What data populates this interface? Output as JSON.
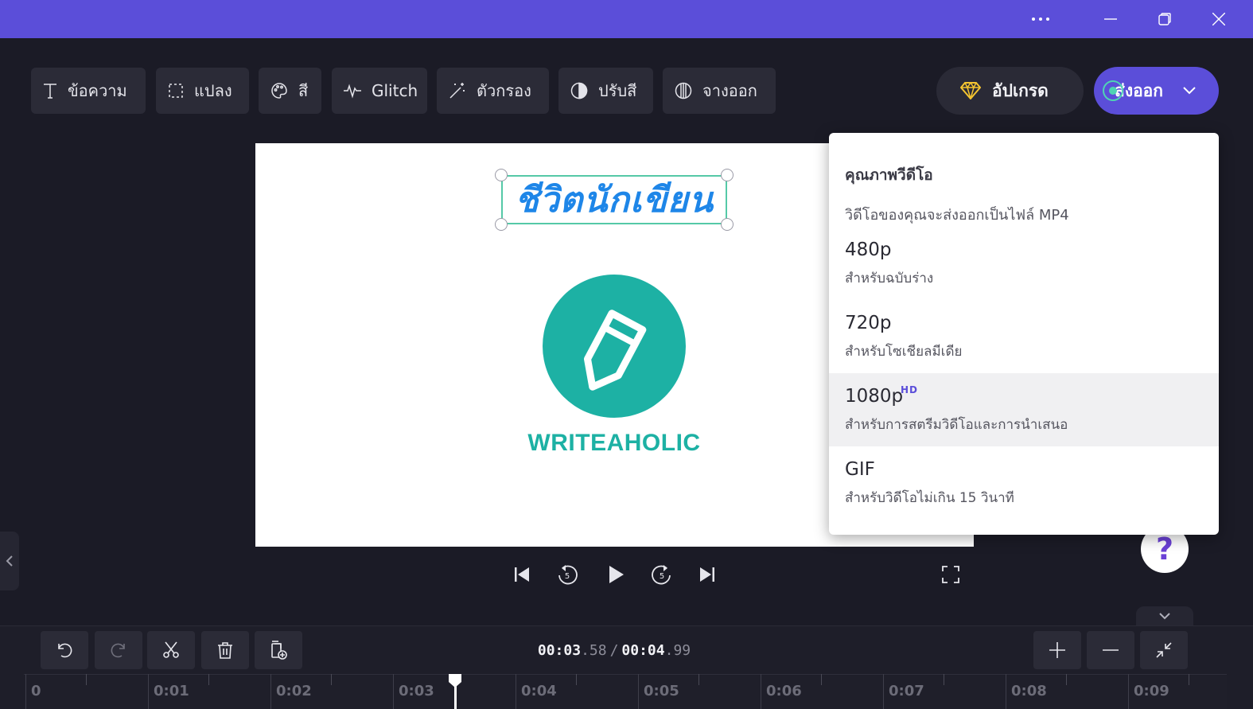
{
  "titlebar": {
    "more_icon": "ellipsis-icon",
    "minimize_icon": "minimize-icon",
    "maximize_icon": "restore-icon",
    "close_icon": "close-icon",
    "color": "#5b4ed9"
  },
  "toolbar": {
    "items": [
      {
        "label": "ข้อความ",
        "icon": "text-icon"
      },
      {
        "label": "แปลง",
        "icon": "transform-icon"
      },
      {
        "label": "สี",
        "icon": "palette-icon"
      },
      {
        "label": "Glitch",
        "icon": "glitch-icon"
      },
      {
        "label": "ตัวกรอง",
        "icon": "magic-wand-icon"
      },
      {
        "label": "ปรับสี",
        "icon": "contrast-icon"
      },
      {
        "label": "จางออก",
        "icon": "fade-icon"
      }
    ],
    "upgrade_label": "อัปเกรด",
    "export_label": "ส่งออก",
    "accent": "#5b4ed9"
  },
  "canvas": {
    "title_text": "ชีวิตนักเขียน",
    "logo_text": "WRITEAHOLIC",
    "logo_color": "#1db1a4"
  },
  "export_menu": {
    "heading": "คุณภาพวีดีโอ",
    "subtitle": "วิดีโอของคุณจะส่งออกเป็นไฟล์ MP4",
    "options": [
      {
        "title": "480p",
        "desc": "สำหรับฉบับร่าง"
      },
      {
        "title": "720p",
        "desc": "สำหรับโซเชียลมีเดีย"
      },
      {
        "title": "1080p",
        "desc": "สำหรับการสตรีมวิดีโอและการนำเสนอ",
        "badge": "HD"
      },
      {
        "title": "GIF",
        "desc": "สำหรับวิดีโอไม่เกิน 15 วินาที"
      }
    ],
    "highlighted": "1080p"
  },
  "playback": {
    "controls": [
      "skip-to-start-icon",
      "rewind-5-icon",
      "play-icon",
      "forward-5-icon",
      "skip-to-end-icon",
      "fullscreen-icon"
    ]
  },
  "help": {
    "label": "?"
  },
  "timeline": {
    "current_main": "00:03",
    "current_frac": ".58",
    "separator": "/",
    "total_main": "00:04",
    "total_frac": ".99",
    "ruler_labels": [
      "0",
      "0:01",
      "0:02",
      "0:03",
      "0:04",
      "0:05",
      "0:06",
      "0:07",
      "0:08",
      "0:09"
    ],
    "tools": [
      "undo-icon",
      "redo-icon",
      "scissors-icon",
      "trash-icon",
      "duplicate-icon"
    ],
    "zoom": [
      "zoom-in-icon",
      "zoom-out-icon",
      "fit-icon"
    ]
  }
}
